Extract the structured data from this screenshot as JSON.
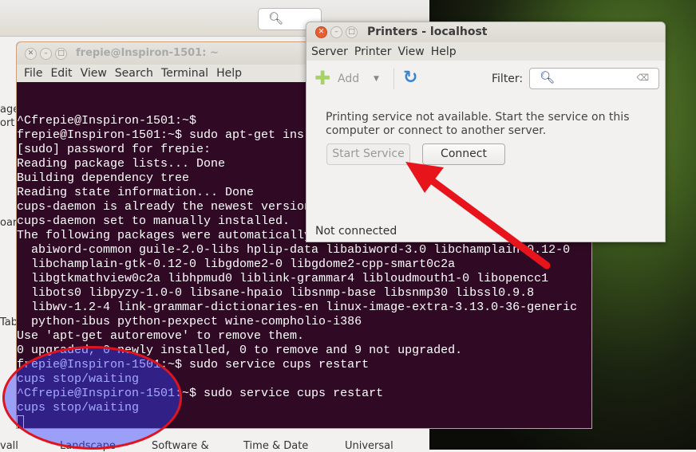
{
  "background": {
    "side_labels": [
      "age",
      "ort",
      "oard",
      "Tab"
    ],
    "bottom_labels": [
      "vall",
      "Landscape",
      "Software &",
      "Time & Date",
      "Universal"
    ],
    "search_icon": "search-icon"
  },
  "terminal": {
    "title": "frepie@Inspiron-1501: ~",
    "menu": [
      "File",
      "Edit",
      "View",
      "Search",
      "Terminal",
      "Help"
    ],
    "lines": [
      "^Cfrepie@Inspiron-1501:~$",
      "frepie@Inspiron-1501:~$ sudo apt-get ins",
      "[sudo] password for frepie:",
      "Reading package lists... Done",
      "Building dependency tree",
      "Reading state information... Done",
      "cups-daemon is already the newest version",
      "cups-daemon set to manually installed.",
      "The following packages were automatically",
      "  abiword-common guile-2.0-libs hplip-data libabiword-3.0 libchamplain-0.12-0",
      "  libchamplain-gtk-0.12-0 libgdome2-0 libgdome2-cpp-smart0c2a",
      "  libgtkmathview0c2a libhpmud0 liblink-grammar4 libloudmouth1-0 libopencc1",
      "  libots0 libpyzy-1.0-0 libsane-hpaio libsnmp-base libsnmp30 libssl0.9.8",
      "  libwv-1.2-4 link-grammar-dictionaries-en linux-image-extra-3.13.0-36-generic",
      "  python-ibus python-pexpect wine-compholio-i386",
      "Use 'apt-get autoremove' to remove them.",
      "0 upgraded, 0 newly installed, 0 to remove and 9 not upgraded.",
      "frepie@Inspiron-1501:~$ sudo service cups restart",
      "cups stop/waiting",
      "^Cfrepie@Inspiron-1501:~$ sudo service cups restart",
      "cups stop/waiting"
    ],
    "colors": {
      "background": "#300a24",
      "text": "#ffffff"
    }
  },
  "printers": {
    "title": "Printers - localhost",
    "menu": [
      "Server",
      "Printer",
      "View",
      "Help"
    ],
    "add_label": "Add",
    "filter_label": "Filter:",
    "filter_value": "",
    "message": "Printing service not available.  Start the service on this computer or connect to another server.",
    "start_service_label": "Start Service",
    "connect_label": "Connect",
    "status": "Not connected"
  },
  "annotations": {
    "color": "#e0141c"
  }
}
